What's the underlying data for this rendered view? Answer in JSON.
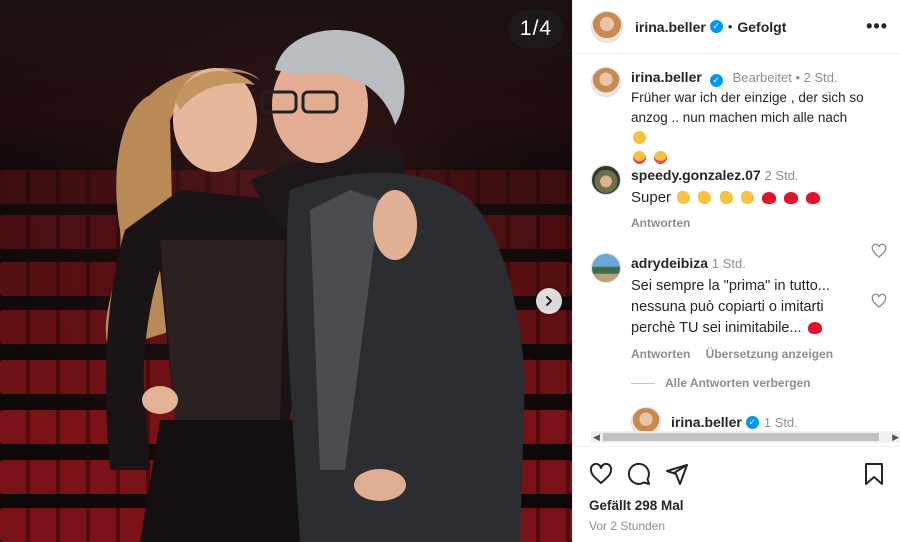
{
  "media": {
    "counter": "1/4",
    "next_icon": "chevron-right-icon"
  },
  "post": {
    "author": "irina.beller",
    "follow_status": "Gefolgt",
    "more_icon": "more-horizontal-icon"
  },
  "comments": [
    {
      "username": "irina.beller",
      "verified": true,
      "meta": "Bearbeitet • 2 Std.",
      "text": "Früher war ich der einzige , der sich so anzog .. nun machen mich alle nach",
      "emojis": [
        "winking-face-tongue",
        "heart-eyes",
        "heart-eyes"
      ]
    },
    {
      "username": "speedy.gonzalez.07",
      "meta": "2 Std.",
      "text": "Super",
      "emojis": [
        "clap",
        "clap",
        "clap",
        "clap",
        "red-heart",
        "red-heart",
        "red-heart"
      ],
      "reply_label": "Antworten"
    },
    {
      "username": "adrydeibiza",
      "meta": "1 Std.",
      "text": "Sei sempre la \"prima\" in tutto... nessuna può copiarti o imitarti perchè TU sei inimitabile...",
      "emojis": [
        "red-heart"
      ],
      "reply_label": "Antworten",
      "translate_label": "Übersetzung anzeigen"
    }
  ],
  "hide_replies_label": "Alle Antworten verbergen",
  "reply_preview": {
    "username": "irina.beller",
    "meta": "1 Std."
  },
  "footer": {
    "likes": "Gefällt 298 Mal",
    "time": "Vor 2 Stunden"
  },
  "colors": {
    "verified": "#0095f6",
    "heart": "#e4122d",
    "muted": "#8e8e8e"
  }
}
